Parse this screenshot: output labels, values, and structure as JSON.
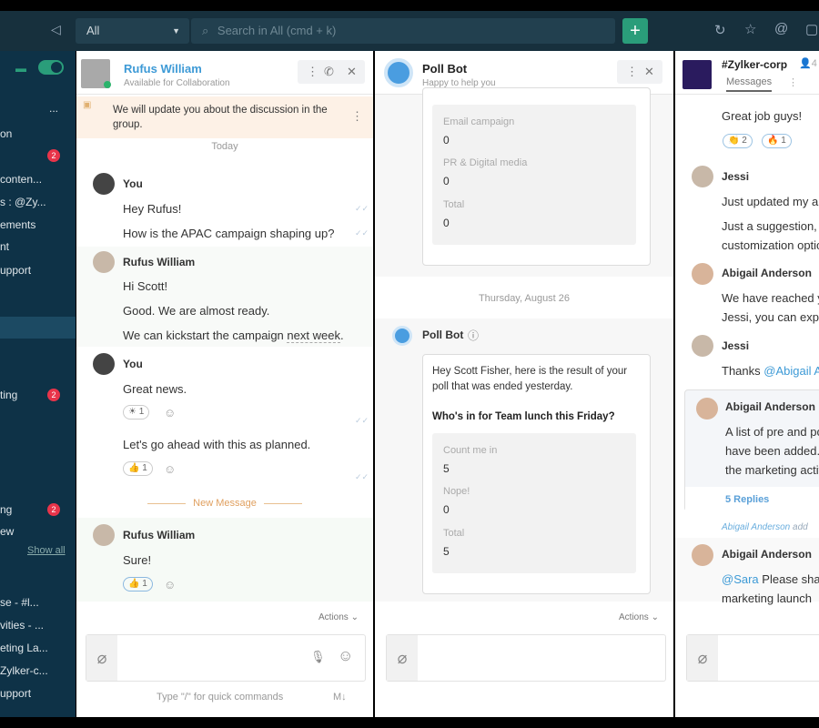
{
  "topbar": {
    "filter": "All",
    "search_placeholder": "Search in All (cmd + k)",
    "add": "+"
  },
  "sidebar": {
    "more": "...",
    "items": [
      {
        "label": "on"
      },
      {
        "label": "",
        "badge": "2"
      },
      {
        "label": "conten..."
      },
      {
        "label": "s : @Zy..."
      },
      {
        "label": "ements"
      },
      {
        "label": "nt"
      },
      {
        "label": "upport"
      },
      {
        "label": "ting",
        "badge": "2"
      },
      {
        "label": "ng",
        "badge": "2"
      },
      {
        "label": "ew"
      },
      {
        "label": "se - #l..."
      },
      {
        "label": "vities - ..."
      },
      {
        "label": "eting La..."
      },
      {
        "label": "Zylker-c..."
      },
      {
        "label": "upport"
      }
    ],
    "show_all": "Show all"
  },
  "chat1": {
    "name": "Rufus William",
    "status": "Available for Collaboration",
    "pinned": "We will update you about the discussion in the group.",
    "today": "Today",
    "m1_sender": "You",
    "m1a": "Hey Rufus!",
    "m1b": "How is the APAC campaign shaping up?",
    "m2_sender": "Rufus William",
    "m2a": "Hi Scott!",
    "m2b": "Good. We are almost ready.",
    "m2c": "We can kickstart the campaign",
    "m2c_link": "next week",
    "m2c_end": ".",
    "m3_sender": "You",
    "m3a": "Great news.",
    "r1": "1",
    "m3b": "Let's go ahead with this as planned.",
    "r2": "1",
    "new_message": "New Message",
    "m4_sender": "Rufus William",
    "m4a": "Sure!",
    "r3": "1",
    "actions": "Actions",
    "hint": "Type \"/\" for quick commands",
    "md": "M↓"
  },
  "chat2": {
    "name": "Poll Bot",
    "status": "Happy to help you",
    "poll1": [
      {
        "label": "Email campaign",
        "value": "0"
      },
      {
        "label": "PR & Digital media",
        "value": "0"
      },
      {
        "label": "Total",
        "value": "0"
      }
    ],
    "date": "Thursday, August 26",
    "sender": "Poll Bot",
    "intro": "Hey Scott Fisher, here is the result of your poll that was ended yesterday.",
    "question": "Who's in for Team lunch this Friday?",
    "poll2": [
      {
        "label": "Count me in",
        "value": "5"
      },
      {
        "label": "Nope!",
        "value": "0"
      },
      {
        "label": "Total",
        "value": "5"
      }
    ],
    "actions": "Actions"
  },
  "chat3": {
    "name": "#Zylker-corp",
    "members": "4",
    "tab": "Messages",
    "m0": "Great job guys!",
    "r1": "2",
    "r2": "1",
    "s1": "Jessi",
    "s1a": "Just updated my ap",
    "s1b": "Just a suggestion, c",
    "s1c": "customization optio",
    "s2": "Abigail Anderson",
    "s2a": "We have reached y",
    "s2b": "Jessi, you can expec",
    "s3": "Jessi",
    "s3a": "Thanks",
    "s3a_mention": "@Abigail An",
    "s4": "Abigail Anderson",
    "s4a": "A list of pre and po",
    "s4b": "have been added.",
    "s4c": "the marketing activ",
    "replies": "5 Replies",
    "info_name": "Abigail Anderson",
    "info_rest": "add",
    "s5": "Abigail Anderson",
    "s5_mention": "@Sara",
    "s5a": "Please share",
    "s5b": "marketing launch"
  }
}
